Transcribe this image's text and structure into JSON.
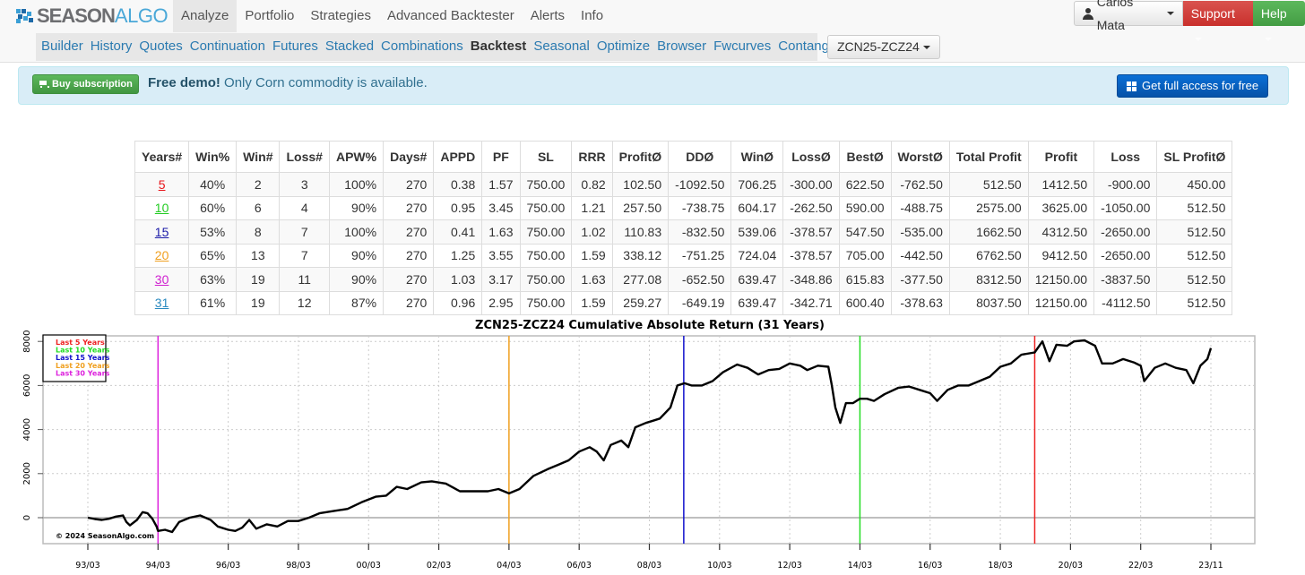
{
  "brand": {
    "part1": "SEASON",
    "part2": "ALGO"
  },
  "main_nav": [
    {
      "label": "Analyze",
      "active": true
    },
    {
      "label": "Portfolio",
      "active": false
    },
    {
      "label": "Strategies",
      "active": false
    },
    {
      "label": "Advanced Backtester",
      "active": false
    },
    {
      "label": "Alerts",
      "active": false
    },
    {
      "label": "Info",
      "active": false
    }
  ],
  "sub_nav": [
    {
      "label": "Builder",
      "active": false
    },
    {
      "label": "History",
      "active": false
    },
    {
      "label": "Quotes",
      "active": false
    },
    {
      "label": "Continuation",
      "active": false
    },
    {
      "label": "Futures",
      "active": false
    },
    {
      "label": "Stacked",
      "active": false
    },
    {
      "label": "Combinations",
      "active": false
    },
    {
      "label": "Backtest",
      "active": true
    },
    {
      "label": "Seasonal",
      "active": false
    },
    {
      "label": "Optimize",
      "active": false
    },
    {
      "label": "Browser",
      "active": false
    },
    {
      "label": "Fwcurves",
      "active": false
    },
    {
      "label": "Contango",
      "active": false
    }
  ],
  "symbol_selector": {
    "value": "ZCN25-ZCZ24"
  },
  "user_menu": {
    "name": "Carlos Mata",
    "support_label": "Support",
    "help_label": "Help"
  },
  "alert": {
    "buy_label": "Buy subscription",
    "bold_text": "Free demo!",
    "text": " Only Corn commodity is available.",
    "cta_label": "Get full access for free"
  },
  "stats_table": {
    "headers": [
      "Years#",
      "Win%",
      "Win#",
      "Loss#",
      "APW%",
      "Days#",
      "APPD",
      "PF",
      "SL",
      "RRR",
      "ProfitØ",
      "DDØ",
      "WinØ",
      "LossØ",
      "BestØ",
      "WorstØ",
      "Total Profit",
      "Profit",
      "Loss",
      "SL ProfitØ"
    ],
    "rows": [
      {
        "years": "5",
        "years_color": "#e8141a",
        "cells": [
          "40%",
          "2",
          "3",
          "100%",
          "270",
          "0.38",
          "1.57",
          "750.00",
          "0.82",
          "102.50",
          "-1092.50",
          "706.25",
          "-300.00",
          "622.50",
          "-762.50",
          "512.50",
          "1412.50",
          "-900.00",
          "450.00"
        ]
      },
      {
        "years": "10",
        "years_color": "#22cc22",
        "cells": [
          "60%",
          "6",
          "4",
          "90%",
          "270",
          "0.95",
          "3.45",
          "750.00",
          "1.21",
          "257.50",
          "-738.75",
          "604.17",
          "-262.50",
          "590.00",
          "-488.75",
          "2575.00",
          "3625.00",
          "-1050.00",
          "512.50"
        ]
      },
      {
        "years": "15",
        "years_color": "#1a1aa8",
        "cells": [
          "53%",
          "8",
          "7",
          "100%",
          "270",
          "0.41",
          "1.63",
          "750.00",
          "1.02",
          "110.83",
          "-832.50",
          "539.06",
          "-378.57",
          "547.50",
          "-535.00",
          "1662.50",
          "4312.50",
          "-2650.00",
          "512.50"
        ]
      },
      {
        "years": "20",
        "years_color": "#f0a020",
        "cells": [
          "65%",
          "13",
          "7",
          "90%",
          "270",
          "1.25",
          "3.55",
          "750.00",
          "1.59",
          "338.12",
          "-751.25",
          "724.04",
          "-378.57",
          "705.00",
          "-442.50",
          "6762.50",
          "9412.50",
          "-2650.00",
          "512.50"
        ]
      },
      {
        "years": "30",
        "years_color": "#d020d0",
        "cells": [
          "63%",
          "19",
          "11",
          "90%",
          "270",
          "1.03",
          "3.17",
          "750.00",
          "1.63",
          "277.08",
          "-652.50",
          "639.47",
          "-348.86",
          "615.83",
          "-377.50",
          "8312.50",
          "12150.00",
          "-3837.50",
          "512.50"
        ]
      },
      {
        "years": "31",
        "years_color": "#2a8ac0",
        "cells": [
          "61%",
          "19",
          "12",
          "87%",
          "270",
          "0.96",
          "2.95",
          "750.00",
          "1.59",
          "259.27",
          "-649.19",
          "639.47",
          "-342.71",
          "600.40",
          "-378.63",
          "8037.50",
          "12150.00",
          "-4112.50",
          "512.50"
        ]
      }
    ]
  },
  "chart_data": {
    "type": "line",
    "title": "ZCN25-ZCZ24 Cumulative Absolute Return (31 Years)",
    "xlabel": "",
    "ylabel": "",
    "x_tick_labels": [
      "93/03",
      "94/03",
      "96/03",
      "98/03",
      "00/03",
      "02/03",
      "04/03",
      "06/03",
      "08/03",
      "10/03",
      "12/03",
      "14/03",
      "16/03",
      "18/03",
      "20/03",
      "22/03",
      "23/11"
    ],
    "y_ticks": [
      0,
      2000,
      4000,
      6000,
      8000
    ],
    "ylim": [
      -1200,
      8200
    ],
    "grid": true,
    "legend_position": "top-left",
    "legend": [
      {
        "label": "Last 5 Years",
        "color": "#ee2222"
      },
      {
        "label": "Last 10 Years",
        "color": "#22dd22"
      },
      {
        "label": "Last 15 Years",
        "color": "#1111cc"
      },
      {
        "label": "Last 20 Years",
        "color": "#f0a020"
      },
      {
        "label": "Last 30 Years",
        "color": "#dd22dd"
      }
    ],
    "markers": [
      {
        "label": "Last 30 Years",
        "x_index": 1.0,
        "color": "#dd22dd"
      },
      {
        "label": "Last 20 Years",
        "x_index": 6.0,
        "color": "#f0a020"
      },
      {
        "label": "Last 15 Years",
        "x_index": 8.49,
        "color": "#1111cc"
      },
      {
        "label": "Last 10 Years",
        "x_index": 11.0,
        "color": "#22dd22"
      },
      {
        "label": "Last 5 Years",
        "x_index": 13.49,
        "color": "#ee2222"
      }
    ],
    "copyright": "© 2024 SeasonAlgo.com",
    "series": [
      {
        "name": "Cumulative Absolute Return",
        "color": "#000000",
        "points": [
          [
            0.0,
            0
          ],
          [
            0.1,
            -60
          ],
          [
            0.2,
            -100
          ],
          [
            0.3,
            -50
          ],
          [
            0.4,
            50
          ],
          [
            0.5,
            100
          ],
          [
            0.55,
            -200
          ],
          [
            0.6,
            -350
          ],
          [
            0.7,
            -100
          ],
          [
            0.78,
            250
          ],
          [
            0.85,
            200
          ],
          [
            0.92,
            -50
          ],
          [
            0.98,
            -400
          ],
          [
            1.0,
            -600
          ],
          [
            1.1,
            -550
          ],
          [
            1.2,
            -650
          ],
          [
            1.3,
            -200
          ],
          [
            1.45,
            0
          ],
          [
            1.6,
            100
          ],
          [
            1.75,
            -100
          ],
          [
            1.85,
            -400
          ],
          [
            2.0,
            -550
          ],
          [
            2.1,
            -600
          ],
          [
            2.2,
            -450
          ],
          [
            2.3,
            -100
          ],
          [
            2.4,
            -500
          ],
          [
            2.55,
            -300
          ],
          [
            2.7,
            -400
          ],
          [
            2.85,
            -150
          ],
          [
            3.0,
            -150
          ],
          [
            3.15,
            0
          ],
          [
            3.3,
            200
          ],
          [
            3.5,
            300
          ],
          [
            3.7,
            400
          ],
          [
            3.9,
            700
          ],
          [
            4.1,
            950
          ],
          [
            4.25,
            1000
          ],
          [
            4.4,
            1400
          ],
          [
            4.55,
            1300
          ],
          [
            4.75,
            1600
          ],
          [
            4.9,
            1650
          ],
          [
            5.1,
            1550
          ],
          [
            5.3,
            1200
          ],
          [
            5.5,
            1200
          ],
          [
            5.7,
            1200
          ],
          [
            5.85,
            1300
          ],
          [
            6.0,
            1100
          ],
          [
            6.15,
            1300
          ],
          [
            6.35,
            1900
          ],
          [
            6.55,
            2200
          ],
          [
            6.7,
            2400
          ],
          [
            6.85,
            2600
          ],
          [
            7.0,
            3000
          ],
          [
            7.15,
            3200
          ],
          [
            7.25,
            3000
          ],
          [
            7.35,
            2600
          ],
          [
            7.45,
            3300
          ],
          [
            7.6,
            3500
          ],
          [
            7.7,
            3200
          ],
          [
            7.8,
            4100
          ],
          [
            7.95,
            4300
          ],
          [
            8.05,
            4400
          ],
          [
            8.15,
            4500
          ],
          [
            8.3,
            5000
          ],
          [
            8.4,
            6000
          ],
          [
            8.5,
            6100
          ],
          [
            8.6,
            6000
          ],
          [
            8.75,
            6000
          ],
          [
            8.9,
            6200
          ],
          [
            9.05,
            6600
          ],
          [
            9.25,
            6950
          ],
          [
            9.4,
            6800
          ],
          [
            9.55,
            6500
          ],
          [
            9.7,
            6700
          ],
          [
            9.85,
            6750
          ],
          [
            10.0,
            7000
          ],
          [
            10.15,
            6900
          ],
          [
            10.25,
            6700
          ],
          [
            10.4,
            6900
          ],
          [
            10.55,
            6850
          ],
          [
            10.6,
            6000
          ],
          [
            10.65,
            5000
          ],
          [
            10.72,
            4300
          ],
          [
            10.8,
            5200
          ],
          [
            10.9,
            5200
          ],
          [
            11.0,
            5400
          ],
          [
            11.1,
            5400
          ],
          [
            11.2,
            5300
          ],
          [
            11.35,
            5600
          ],
          [
            11.55,
            5900
          ],
          [
            11.7,
            5950
          ],
          [
            11.85,
            5800
          ],
          [
            12.0,
            5650
          ],
          [
            12.1,
            5300
          ],
          [
            12.25,
            5800
          ],
          [
            12.4,
            6000
          ],
          [
            12.55,
            6000
          ],
          [
            12.7,
            6200
          ],
          [
            12.85,
            6400
          ],
          [
            13.0,
            6850
          ],
          [
            13.15,
            7000
          ],
          [
            13.3,
            7400
          ],
          [
            13.49,
            7500
          ],
          [
            13.6,
            8000
          ],
          [
            13.7,
            7100
          ],
          [
            13.8,
            7850
          ],
          [
            13.95,
            7800
          ],
          [
            14.05,
            8000
          ],
          [
            14.2,
            8050
          ],
          [
            14.35,
            7800
          ],
          [
            14.45,
            7000
          ],
          [
            14.6,
            7000
          ],
          [
            14.75,
            7200
          ],
          [
            14.9,
            7050
          ],
          [
            15.0,
            6900
          ],
          [
            15.05,
            6200
          ],
          [
            15.2,
            6800
          ],
          [
            15.35,
            7000
          ],
          [
            15.5,
            6800
          ],
          [
            15.65,
            6700
          ],
          [
            15.75,
            6100
          ],
          [
            15.85,
            6900
          ],
          [
            15.95,
            7200
          ],
          [
            16.0,
            7700
          ]
        ]
      }
    ]
  }
}
